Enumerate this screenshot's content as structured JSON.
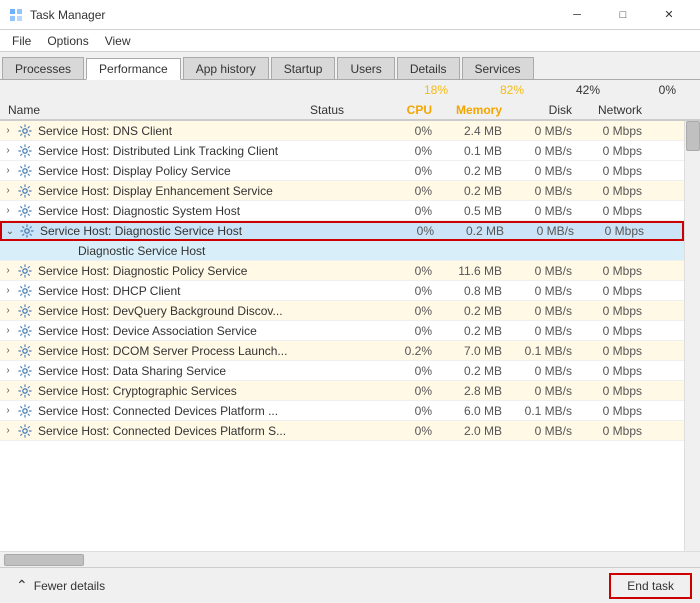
{
  "window": {
    "title": "Task Manager",
    "controls": {
      "minimize": "─",
      "maximize": "□",
      "close": "✕"
    }
  },
  "menu": {
    "items": [
      "File",
      "Options",
      "View"
    ]
  },
  "tabs": [
    {
      "label": "Processes",
      "active": false
    },
    {
      "label": "Performance",
      "active": false
    },
    {
      "label": "App history",
      "active": false
    },
    {
      "label": "Startup",
      "active": false
    },
    {
      "label": "Users",
      "active": false
    },
    {
      "label": "Details",
      "active": false
    },
    {
      "label": "Services",
      "active": false
    }
  ],
  "headers": {
    "cpu_pct": "18%",
    "memory_pct": "82%",
    "disk_pct": "42%",
    "network_pct": "0%",
    "cpu_label": "CPU",
    "memory_label": "Memory",
    "disk_label": "Disk",
    "network_label": "Network",
    "name_label": "Name",
    "status_label": "Status"
  },
  "rows": [
    {
      "indent": false,
      "expand": "›",
      "name": "Service Host: DNS Client",
      "status": "",
      "cpu": "0%",
      "memory": "2.4 MB",
      "disk": "0 MB/s",
      "network": "0 Mbps",
      "highlight": true,
      "selected": false
    },
    {
      "indent": false,
      "expand": "›",
      "name": "Service Host: Distributed Link Tracking Client",
      "status": "",
      "cpu": "0%",
      "memory": "0.1 MB",
      "disk": "0 MB/s",
      "network": "0 Mbps",
      "highlight": false,
      "selected": false
    },
    {
      "indent": false,
      "expand": "›",
      "name": "Service Host: Display Policy Service",
      "status": "",
      "cpu": "0%",
      "memory": "0.2 MB",
      "disk": "0 MB/s",
      "network": "0 Mbps",
      "highlight": false,
      "selected": false
    },
    {
      "indent": false,
      "expand": "›",
      "name": "Service Host: Display Enhancement Service",
      "status": "",
      "cpu": "0%",
      "memory": "0.2 MB",
      "disk": "0 MB/s",
      "network": "0 Mbps",
      "highlight": true,
      "selected": false
    },
    {
      "indent": false,
      "expand": "›",
      "name": "Service Host: Diagnostic System Host",
      "status": "",
      "cpu": "0%",
      "memory": "0.5 MB",
      "disk": "0 MB/s",
      "network": "0 Mbps",
      "highlight": false,
      "selected": false
    },
    {
      "indent": false,
      "expand": "⌄",
      "name": "Service Host: Diagnostic Service Host",
      "status": "",
      "cpu": "0%",
      "memory": "0.2 MB",
      "disk": "0 MB/s",
      "network": "0 Mbps",
      "highlight": false,
      "selected": true,
      "selectedBorder": true
    },
    {
      "indent": true,
      "expand": "",
      "name": "Diagnostic Service Host",
      "status": "",
      "cpu": "",
      "memory": "",
      "disk": "",
      "network": "",
      "highlight": false,
      "selected": true,
      "sub": true
    },
    {
      "indent": false,
      "expand": "›",
      "name": "Service Host: Diagnostic Policy Service",
      "status": "",
      "cpu": "0%",
      "memory": "11.6 MB",
      "disk": "0 MB/s",
      "network": "0 Mbps",
      "highlight": true,
      "selected": false
    },
    {
      "indent": false,
      "expand": "›",
      "name": "Service Host: DHCP Client",
      "status": "",
      "cpu": "0%",
      "memory": "0.8 MB",
      "disk": "0 MB/s",
      "network": "0 Mbps",
      "highlight": false,
      "selected": false
    },
    {
      "indent": false,
      "expand": "›",
      "name": "Service Host: DevQuery Background Discov...",
      "status": "",
      "cpu": "0%",
      "memory": "0.2 MB",
      "disk": "0 MB/s",
      "network": "0 Mbps",
      "highlight": true,
      "selected": false
    },
    {
      "indent": false,
      "expand": "›",
      "name": "Service Host: Device Association Service",
      "status": "",
      "cpu": "0%",
      "memory": "0.2 MB",
      "disk": "0 MB/s",
      "network": "0 Mbps",
      "highlight": false,
      "selected": false
    },
    {
      "indent": false,
      "expand": "›",
      "name": "Service Host: DCOM Server Process Launch...",
      "status": "",
      "cpu": "0.2%",
      "memory": "7.0 MB",
      "disk": "0.1 MB/s",
      "network": "0 Mbps",
      "highlight": true,
      "selected": false
    },
    {
      "indent": false,
      "expand": "›",
      "name": "Service Host: Data Sharing Service",
      "status": "",
      "cpu": "0%",
      "memory": "0.2 MB",
      "disk": "0 MB/s",
      "network": "0 Mbps",
      "highlight": false,
      "selected": false
    },
    {
      "indent": false,
      "expand": "›",
      "name": "Service Host: Cryptographic Services",
      "status": "",
      "cpu": "0%",
      "memory": "2.8 MB",
      "disk": "0 MB/s",
      "network": "0 Mbps",
      "highlight": true,
      "selected": false
    },
    {
      "indent": false,
      "expand": "›",
      "name": "Service Host: Connected Devices Platform ...",
      "status": "",
      "cpu": "0%",
      "memory": "6.0 MB",
      "disk": "0.1 MB/s",
      "network": "0 Mbps",
      "highlight": false,
      "selected": false
    },
    {
      "indent": false,
      "expand": "›",
      "name": "Service Host: Connected Devices Platform S...",
      "status": "",
      "cpu": "0%",
      "memory": "2.0 MB",
      "disk": "0 MB/s",
      "network": "0 Mbps",
      "highlight": true,
      "selected": false
    }
  ],
  "bottom": {
    "fewer_details": "Fewer details",
    "end_task": "End task"
  }
}
